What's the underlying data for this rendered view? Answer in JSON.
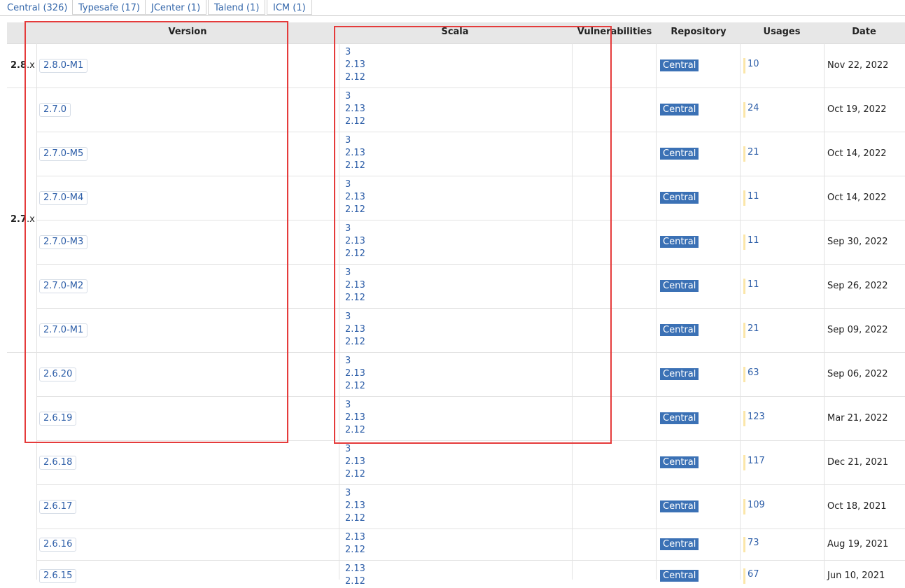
{
  "tabs": [
    {
      "label": "Central (326)"
    },
    {
      "label": "Typesafe (17)"
    },
    {
      "label": "JCenter (1)"
    },
    {
      "label": "Talend (1)"
    },
    {
      "label": "ICM (1)"
    }
  ],
  "headers": {
    "version": "Version",
    "scala": "Scala",
    "vulnerabilities": "Vulnerabilities",
    "repository": "Repository",
    "usages": "Usages",
    "date": "Date"
  },
  "groups": [
    {
      "bold": "2.8",
      "rest": ".x"
    },
    {
      "bold": "2.7",
      "rest": ".x"
    }
  ],
  "rows": [
    {
      "version": "2.8.0-M1",
      "scala": [
        "3",
        "2.13",
        "2.12"
      ],
      "repo": "Central",
      "usages": "10",
      "date": "Nov 22, 2022"
    },
    {
      "version": "2.7.0",
      "scala": [
        "3",
        "2.13",
        "2.12"
      ],
      "repo": "Central",
      "usages": "24",
      "date": "Oct 19, 2022"
    },
    {
      "version": "2.7.0-M5",
      "scala": [
        "3",
        "2.13",
        "2.12"
      ],
      "repo": "Central",
      "usages": "21",
      "date": "Oct 14, 2022"
    },
    {
      "version": "2.7.0-M4",
      "scala": [
        "3",
        "2.13",
        "2.12"
      ],
      "repo": "Central",
      "usages": "11",
      "date": "Oct 14, 2022"
    },
    {
      "version": "2.7.0-M3",
      "scala": [
        "3",
        "2.13",
        "2.12"
      ],
      "repo": "Central",
      "usages": "11",
      "date": "Sep 30, 2022"
    },
    {
      "version": "2.7.0-M2",
      "scala": [
        "3",
        "2.13",
        "2.12"
      ],
      "repo": "Central",
      "usages": "11",
      "date": "Sep 26, 2022"
    },
    {
      "version": "2.7.0-M1",
      "scala": [
        "3",
        "2.13",
        "2.12"
      ],
      "repo": "Central",
      "usages": "21",
      "date": "Sep 09, 2022"
    },
    {
      "version": "2.6.20",
      "scala": [
        "3",
        "2.13",
        "2.12"
      ],
      "repo": "Central",
      "usages": "63",
      "date": "Sep 06, 2022"
    },
    {
      "version": "2.6.19",
      "scala": [
        "3",
        "2.13",
        "2.12"
      ],
      "repo": "Central",
      "usages": "123",
      "date": "Mar 21, 2022"
    },
    {
      "version": "2.6.18",
      "scala": [
        "3",
        "2.13",
        "2.12"
      ],
      "repo": "Central",
      "usages": "117",
      "date": "Dec 21, 2021"
    },
    {
      "version": "2.6.17",
      "scala": [
        "3",
        "2.13",
        "2.12"
      ],
      "repo": "Central",
      "usages": "109",
      "date": "Oct 18, 2021"
    },
    {
      "version": "2.6.16",
      "scala": [
        "2.13",
        "2.12"
      ],
      "repo": "Central",
      "usages": "73",
      "date": "Aug 19, 2021"
    },
    {
      "version": "2.6.15",
      "scala": [
        "2.13",
        "2.12"
      ],
      "repo": "Central",
      "usages": "67",
      "date": "Jun 10, 2021"
    }
  ]
}
